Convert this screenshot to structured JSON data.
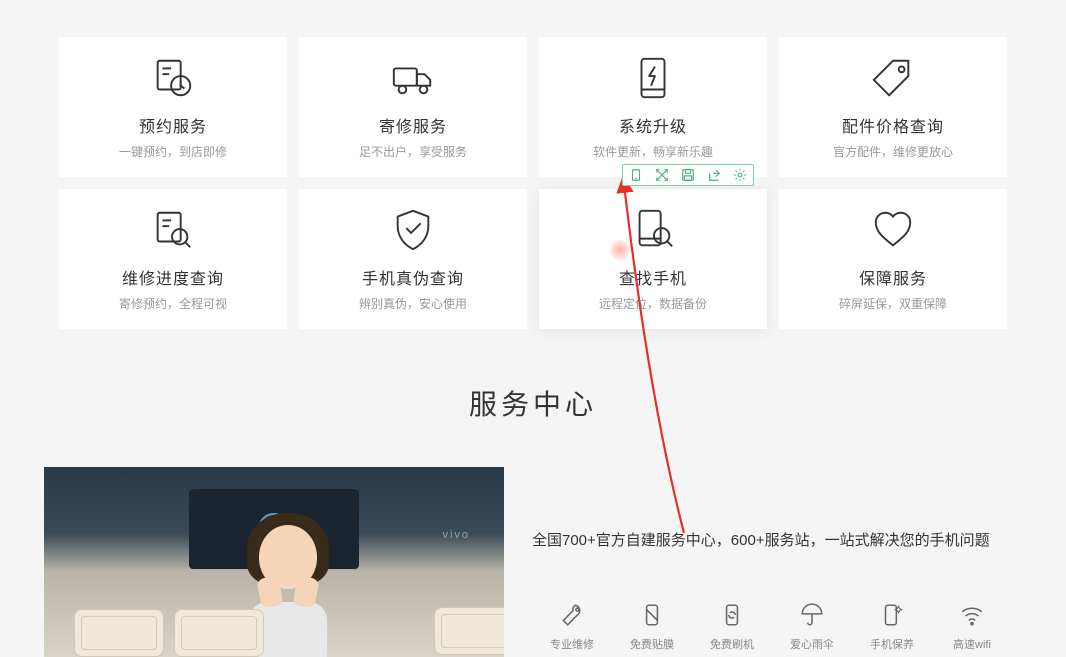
{
  "cards": [
    {
      "title": "预约服务",
      "sub": "一键预约，到店即修"
    },
    {
      "title": "寄修服务",
      "sub": "足不出户，享受服务"
    },
    {
      "title": "系统升级",
      "sub": "软件更新，畅享新乐趣"
    },
    {
      "title": "配件价格查询",
      "sub": "官方配件，维修更放心"
    },
    {
      "title": "维修进度查询",
      "sub": "寄修预约，全程可视"
    },
    {
      "title": "手机真伪查询",
      "sub": "辨别真伪，安心使用"
    },
    {
      "title": "查找手机",
      "sub": "远程定位，数据备份"
    },
    {
      "title": "保障服务",
      "sub": "碎屏延保，双重保障"
    }
  ],
  "section_title": "服务中心",
  "center_desc": "全国700+官方自建服务中心，600+服务站，一站式解决您的手机问题",
  "features": [
    {
      "label": "专业维修"
    },
    {
      "label": "免费贴膜"
    },
    {
      "label": "免费刷机"
    },
    {
      "label": "爱心雨伞"
    },
    {
      "label": "手机保养"
    },
    {
      "label": "高速wifi"
    }
  ],
  "photo_brand": "vivo"
}
